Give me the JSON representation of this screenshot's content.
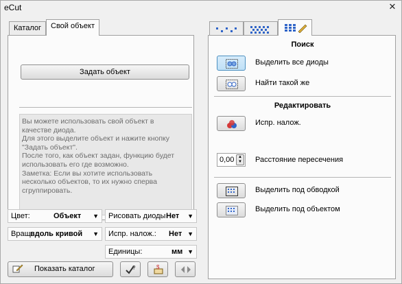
{
  "window": {
    "title": "eCut",
    "close_glyph": "✕"
  },
  "left": {
    "tabs": [
      {
        "label": "Каталог"
      },
      {
        "label": "Свой объект"
      }
    ],
    "define_button": "Задать объект",
    "help_lines": [
      "Вы можете использовать свой объект в",
      "качестве диода.",
      "Для этого выделите объект и нажите кнопку",
      "\"Задать объект\".",
      "После того, как объект задан, функцию будет",
      "использовать его где возможно.",
      "Заметка: Если вы хотите использовать",
      "несколько объектов, то их нужно сперва",
      "сгруппировать."
    ],
    "color": {
      "label": "Цвет:",
      "value": "Объект"
    },
    "rotate": {
      "label": "Вращ",
      "value": "вдоль кривой"
    },
    "draw_diodes": {
      "label": "Рисовать диоды",
      "value": "Нет"
    },
    "fix_overlap": {
      "label": "Испр. налож.:",
      "value": "Нет"
    },
    "units": {
      "label": "Единицы:",
      "value": "мм"
    },
    "show_catalog_button": "Показать каталог",
    "icons": {
      "show_catalog": "catalog-edit-icon",
      "help": "help-check-icon",
      "price": "price-icon",
      "prev_next": "prev-next-icon"
    }
  },
  "right": {
    "tab_icons": [
      "dots-pattern-icon",
      "grid-pattern-icon",
      "grid-edit-icon"
    ],
    "search_title": "Поиск",
    "select_all_label": "Выделить все диоды",
    "find_same_label": "Найти такой же",
    "edit_title": "Редактировать",
    "fix_overlap_label": "Испр. налож.",
    "distance_value": "0,00",
    "distance_label": "Расстояние пересечения",
    "select_under_outline_label": "Выделить под обводкой",
    "select_under_object_label": "Выделить под объектом"
  },
  "colors": {
    "accent": "#4b8fc0",
    "red": "#d43a3a",
    "blue": "#2f64c8"
  }
}
